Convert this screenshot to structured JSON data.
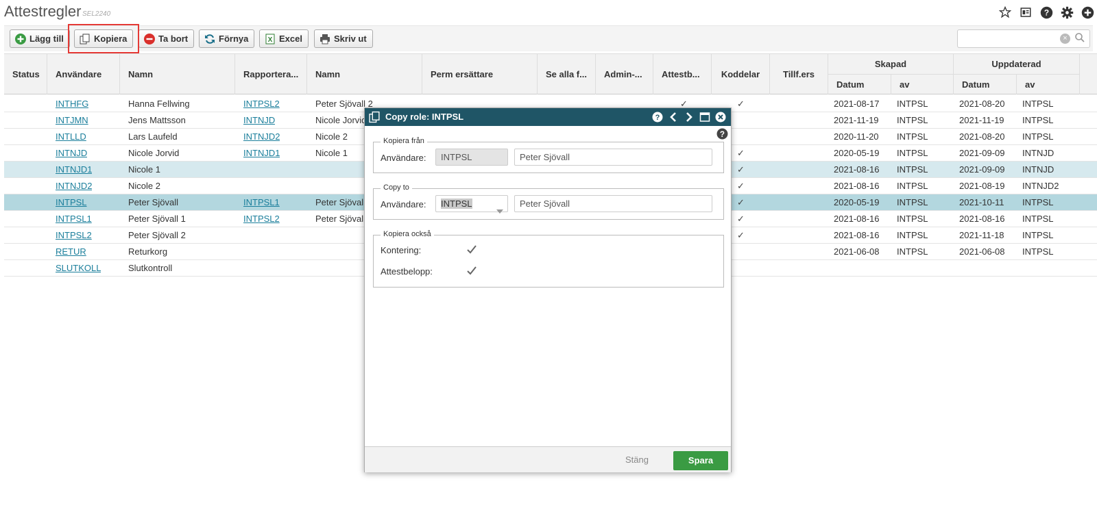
{
  "app": {
    "title": "Attestregler",
    "code": "SEL2240"
  },
  "top_icons": [
    "star-icon",
    "layout-icon",
    "help-icon",
    "gear-icon",
    "add-circle-icon"
  ],
  "toolbar": {
    "add": "Lägg till",
    "copy": "Kopiera",
    "delete": "Ta bort",
    "refresh": "Förnya",
    "excel": "Excel",
    "print": "Skriv ut"
  },
  "search": {
    "placeholder": ""
  },
  "columns": {
    "status": "Status",
    "user": "Användare",
    "name": "Namn",
    "report_to": "Rapportera...",
    "name2": "Namn",
    "perm": "Perm ersättare",
    "see_all": "Se alla f...",
    "admin": "Admin-...",
    "attest": "Attestb...",
    "code_parts": "Koddelar",
    "tillf": "Tillf.ers",
    "created": "Skapad",
    "updated": "Uppdaterad",
    "date": "Datum",
    "by": "av"
  },
  "rows": [
    {
      "user": "INTHFG",
      "name": "Hanna Fellwing",
      "report": "INTPSL2",
      "name2": "Peter Sjövall 2",
      "attest": "✓",
      "codes": "✓",
      "c_date": "2021-08-17",
      "c_by": "INTPSL",
      "u_date": "2021-08-20",
      "u_by": "INTPSL"
    },
    {
      "user": "INTJMN",
      "name": "Jens Mattsson",
      "report": "INTNJD",
      "name2": "Nicole Jorvid",
      "attest": "",
      "codes": "",
      "c_date": "2021-11-19",
      "c_by": "INTPSL",
      "u_date": "2021-11-19",
      "u_by": "INTPSL"
    },
    {
      "user": "INTLLD",
      "name": "Lars Laufeld",
      "report": "INTNJD2",
      "name2": "Nicole 2",
      "attest": "",
      "codes": "",
      "c_date": "2020-11-20",
      "c_by": "INTPSL",
      "u_date": "2021-08-20",
      "u_by": "INTPSL"
    },
    {
      "user": "INTNJD",
      "name": "Nicole Jorvid",
      "report": "INTNJD1",
      "name2": "Nicole 1",
      "attest": "",
      "codes": "✓",
      "c_date": "2020-05-19",
      "c_by": "INTPSL",
      "u_date": "2021-09-09",
      "u_by": "INTNJD"
    },
    {
      "user": "INTNJD1",
      "name": "Nicole 1",
      "report": "",
      "name2": "",
      "attest": "",
      "codes": "✓",
      "c_date": "2021-08-16",
      "c_by": "INTPSL",
      "u_date": "2021-09-09",
      "u_by": "INTNJD"
    },
    {
      "user": "INTNJD2",
      "name": "Nicole 2",
      "report": "",
      "name2": "",
      "attest": "",
      "codes": "✓",
      "c_date": "2021-08-16",
      "c_by": "INTPSL",
      "u_date": "2021-08-19",
      "u_by": "INTNJD2"
    },
    {
      "user": "INTPSL",
      "name": "Peter Sjövall",
      "report": "INTPSL1",
      "name2": "Peter Sjövall",
      "attest": "",
      "codes": "✓",
      "c_date": "2020-05-19",
      "c_by": "INTPSL",
      "u_date": "2021-10-11",
      "u_by": "INTPSL"
    },
    {
      "user": "INTPSL1",
      "name": "Peter Sjövall 1",
      "report": "INTPSL2",
      "name2": "Peter Sjövall",
      "attest": "",
      "codes": "✓",
      "c_date": "2021-08-16",
      "c_by": "INTPSL",
      "u_date": "2021-08-16",
      "u_by": "INTPSL"
    },
    {
      "user": "INTPSL2",
      "name": "Peter Sjövall 2",
      "report": "",
      "name2": "",
      "attest": "",
      "codes": "✓",
      "c_date": "2021-08-16",
      "c_by": "INTPSL",
      "u_date": "2021-11-18",
      "u_by": "INTPSL"
    },
    {
      "user": "RETUR",
      "name": "Returkorg",
      "report": "",
      "name2": "",
      "attest": "",
      "codes": "",
      "c_date": "2021-06-08",
      "c_by": "INTPSL",
      "u_date": "2021-06-08",
      "u_by": "INTPSL"
    },
    {
      "user": "SLUTKOLL",
      "name": "Slutkontroll",
      "report": "",
      "name2": "",
      "attest": "",
      "codes": "",
      "c_date": "",
      "c_by": "",
      "u_date": "",
      "u_by": ""
    }
  ],
  "dialog": {
    "title": "Copy role: INTPSL",
    "from_legend": "Kopiera från",
    "from_label": "Användare:",
    "from_user": "INTPSL",
    "from_name": "Peter Sjövall",
    "to_legend": "Copy to",
    "to_label": "Användare:",
    "to_user": "INTPSL",
    "to_name": "Peter Sjövall",
    "also_legend": "Kopiera också",
    "kontering": "Kontering:",
    "attestbelopp": "Attestbelopp:",
    "close": "Stäng",
    "save": "Spara"
  },
  "colors": {
    "dialog_header": "#1f5566",
    "save_button": "#3a9b43",
    "link": "#1a7e9b",
    "selected_row": "#b3d7df",
    "light_row": "#d6e9ee",
    "highlight": "#e53935"
  }
}
